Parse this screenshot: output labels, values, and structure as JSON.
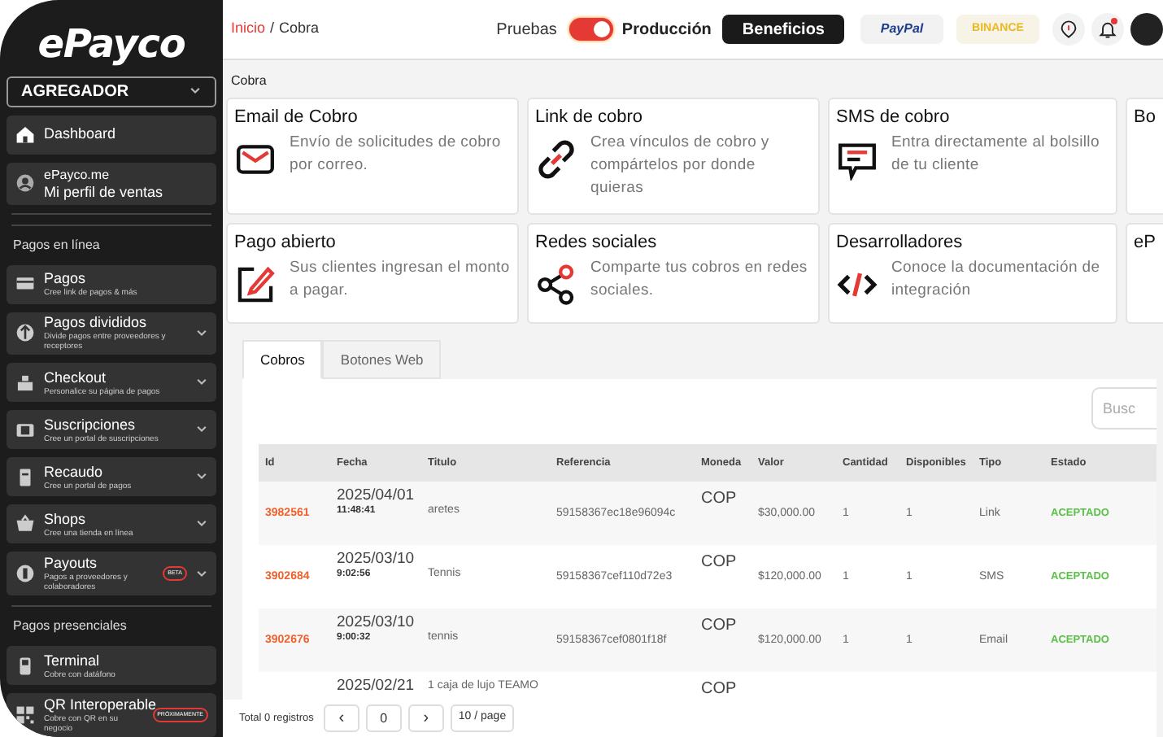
{
  "sidebar": {
    "logo": "ePayco",
    "account_selector": "AGREGADOR",
    "items": [
      {
        "kind": "item",
        "title": "Dashboard",
        "selected": false
      },
      {
        "kind": "profile",
        "title": "ePayco.me",
        "subtitle": "Mi perfil de ventas"
      },
      {
        "kind": "heading",
        "title": "Pagos en línea"
      },
      {
        "kind": "item",
        "title": "Pagos",
        "subtitle": "Cree link de pagos & más",
        "expandable": false
      },
      {
        "kind": "item",
        "title": "Pagos divididos",
        "subtitle": "Divide pagos entre proveedores y receptores",
        "expandable": true
      },
      {
        "kind": "item",
        "title": "Checkout",
        "subtitle": "Personalice su página de pagos",
        "expandable": true
      },
      {
        "kind": "item",
        "title": "Suscripciones",
        "subtitle": "Cree un portal de suscripciones",
        "expandable": true
      },
      {
        "kind": "item",
        "title": "Recaudo",
        "subtitle": "Cree un portal de pagos",
        "expandable": true
      },
      {
        "kind": "item",
        "title": "Shops",
        "subtitle": "Cree una tienda en línea",
        "expandable": true
      },
      {
        "kind": "item",
        "title": "Payouts",
        "subtitle": "Pagos a proveedores y colaboradores",
        "badge": "BETA",
        "expandable": true
      },
      {
        "kind": "heading",
        "title": "Pagos presenciales"
      },
      {
        "kind": "item",
        "title": "Terminal",
        "subtitle": "Cobre con datáfono",
        "expandable": false
      },
      {
        "kind": "item",
        "title": "QR Interoperable",
        "subtitle": "Cobre con QR en su negocio",
        "badge": "PRÓXIMAMENTE",
        "expandable": false
      }
    ]
  },
  "topbar": {
    "breadcrumb": [
      {
        "label": "Inicio",
        "link": true
      },
      {
        "label": "Cobra",
        "link": false
      }
    ],
    "separator": "/",
    "environment": {
      "left_label": "Pruebas",
      "right_label": "Producción",
      "on": true
    },
    "benefits_button": "Beneficios",
    "paypal": "PayPal",
    "binance": "BINANCE",
    "notifications_unread": true
  },
  "section_title": "Cobra",
  "cards": [
    {
      "title": "Email de Cobro",
      "description": "Envío de solicitudes de cobro por correo."
    },
    {
      "title": "Link de cobro",
      "description": "Crea vínculos de cobro y compártelos por donde quieras"
    },
    {
      "title": "SMS de cobro",
      "description": "Entra directamente al bolsillo de tu cliente"
    },
    {
      "title": "Bo"
    },
    {
      "title": "Pago abierto",
      "description": "Sus clientes ingresan el monto a pagar."
    },
    {
      "title": "Redes sociales",
      "description": "Comparte tus cobros en redes sociales."
    },
    {
      "title": "Desarrolladores",
      "description": "Conoce la documentación de integración"
    },
    {
      "title": "eP"
    }
  ],
  "tabs": [
    {
      "label": "Cobros",
      "selected": true
    },
    {
      "label": "Botones Web",
      "selected": false
    }
  ],
  "search": {
    "placeholder": "Busc"
  },
  "table": {
    "columns": [
      "Id",
      "Fecha",
      "Titulo",
      "Referencia",
      "Moneda",
      "Valor",
      "Cantidad",
      "Disponibles",
      "Tipo",
      "Estado"
    ],
    "rows": [
      {
        "id": "3982561",
        "date": "2025/04/01",
        "time": "11:48:41",
        "title": "aretes",
        "reference": "59158367ec18e96094c",
        "currency": "COP",
        "value": "$30,000.00",
        "quantity": "1",
        "available": "1",
        "type": "Link",
        "status": "ACEPTADO"
      },
      {
        "id": "3902684",
        "date": "2025/03/10",
        "time": "9:02:56",
        "title": "Tennis",
        "reference": "59158367cef110d72e3",
        "currency": "COP",
        "value": "$120,000.00",
        "quantity": "1",
        "available": "1",
        "type": "SMS",
        "status": "ACEPTADO"
      },
      {
        "id": "3902676",
        "date": "2025/03/10",
        "time": "9:00:32",
        "title": "tennis",
        "reference": "59158367cef0801f18f",
        "currency": "COP",
        "value": "$120,000.00",
        "quantity": "1",
        "available": "1",
        "type": "Email",
        "status": "ACEPTADO"
      },
      {
        "date": "2025/02/21",
        "title": "1 caja de lujo TEAMO",
        "currency": "COP"
      }
    ]
  },
  "pagination": {
    "total": "Total 0 registros",
    "prev": "‹",
    "page": "0",
    "next": "›",
    "page_size": "10 / page"
  }
}
